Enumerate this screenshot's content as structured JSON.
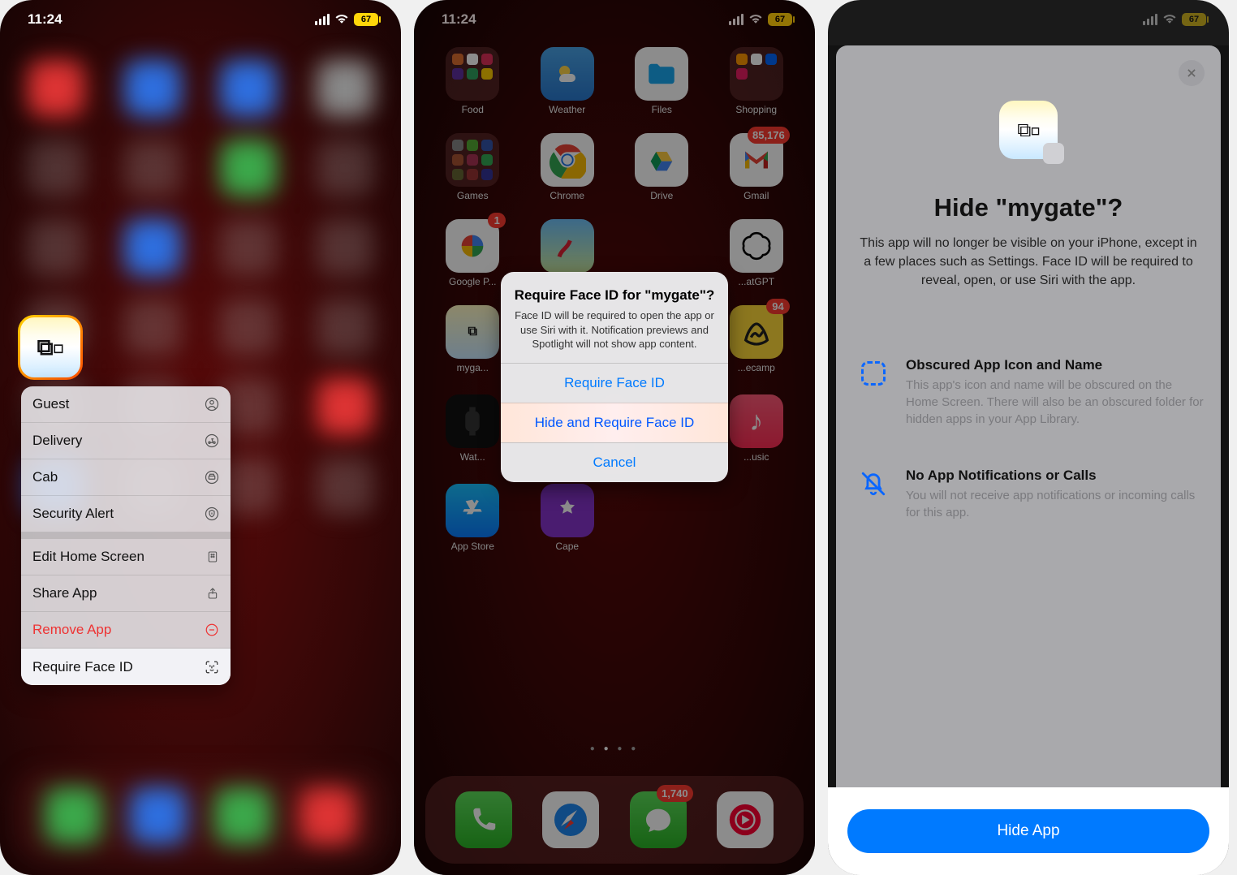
{
  "status": {
    "time": "11:24",
    "battery_pct": "67"
  },
  "screen1": {
    "context_menu": {
      "app_actions": [
        {
          "label": "Guest",
          "icon": "person"
        },
        {
          "label": "Delivery",
          "icon": "moped"
        },
        {
          "label": "Cab",
          "icon": "car"
        },
        {
          "label": "Security Alert",
          "icon": "shield"
        }
      ],
      "system_actions": [
        {
          "label": "Edit Home Screen",
          "icon": "apps"
        },
        {
          "label": "Share App",
          "icon": "share"
        },
        {
          "label": "Remove App",
          "icon": "minus",
          "destructive": true
        },
        {
          "label": "Require Face ID",
          "icon": "faceid",
          "highlighted": true
        }
      ]
    }
  },
  "screen2": {
    "apps": {
      "food": "Food",
      "weather": "Weather",
      "files": "Files",
      "shopping": "Shopping",
      "games": "Games",
      "chrome": "Chrome",
      "drive": "Drive",
      "gmail": {
        "label": "Gmail",
        "badge": "85,176"
      },
      "gphotos": {
        "label": "Google P...",
        "badge": "1"
      },
      "maps_folder": "",
      "chatgpt": "...atGPT",
      "mygate": "myga...",
      "basecamp": {
        "label": "...ecamp",
        "badge": "94"
      },
      "watch": "Wat...",
      "music": "...usic",
      "appstore": "App Store",
      "cape": "Cape"
    },
    "dock_messages_badge": "1,740",
    "alert": {
      "title": "Require Face ID for \"mygate\"?",
      "message": "Face ID will be required to open the app or use Siri with it. Notification previews and Spotlight will not show app content.",
      "btn_require": "Require Face ID",
      "btn_hide": "Hide and Require Face ID",
      "btn_cancel": "Cancel"
    }
  },
  "screen3": {
    "title": "Hide \"mygate\"?",
    "description": "This app will no longer be visible on your iPhone, except in a few places such as Settings. Face ID will be required to reveal, open, or use Siri with the app.",
    "info1": {
      "title": "Obscured App Icon and Name",
      "body": "This app's icon and name will be obscured on the Home Screen. There will also be an obscured folder for hidden apps in your App Library."
    },
    "info2": {
      "title": "No App Notifications or Calls",
      "body": "You will not receive app notifications or incoming calls for this app."
    },
    "hide_button": "Hide App"
  }
}
